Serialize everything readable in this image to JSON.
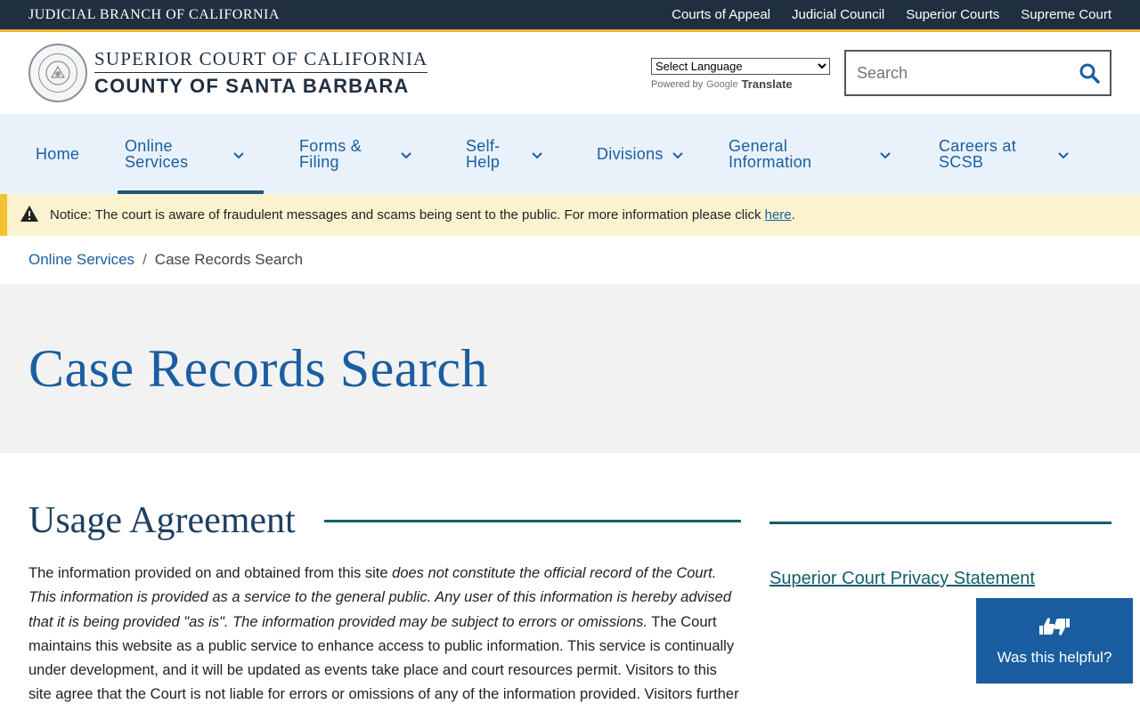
{
  "topbar": {
    "branch": "JUDICIAL BRANCH OF CALIFORNIA",
    "links": [
      "Courts of Appeal",
      "Judicial Council",
      "Superior Courts",
      "Supreme Court"
    ]
  },
  "header": {
    "title_line1": "SUPERIOR COURT OF CALIFORNIA",
    "title_line2": "COUNTY OF SANTA BARBARA",
    "language_select": "Select Language",
    "powered_by": "Powered by",
    "google": "Google",
    "translate": "Translate",
    "search_placeholder": "Search"
  },
  "nav": {
    "items": [
      {
        "label": "Home"
      },
      {
        "label": "Online Services"
      },
      {
        "label": "Forms & Filing"
      },
      {
        "label": "Self-Help"
      },
      {
        "label": "Divisions"
      },
      {
        "label": "General Information"
      },
      {
        "label": "Careers at SCSB"
      }
    ]
  },
  "notice": {
    "prefix": "Notice: The court is aware of fraudulent messages and scams being sent to the public. For more information please click ",
    "link": "here",
    "suffix": "."
  },
  "breadcrumb": {
    "parent": "Online Services",
    "separator": "/",
    "current": "Case Records Search"
  },
  "page": {
    "title": "Case Records Search",
    "section_title": "Usage Agreement",
    "p_start": "The information provided on and obtained from this site ",
    "p_italic": "does not constitute the official record of the Court. This information is provided as a service to the general public. Any user of this information is hereby advised that it is being provided \"as is\". The information provided may be subject to errors or omissions.",
    "p_end": " The Court maintains this website as a public service to enhance access to public information. This service is continually under development, and it will be updated as events take place and court resources permit. Visitors to this site agree that the Court is not liable for errors or omissions of any of the information provided. Visitors further consent"
  },
  "sidebar": {
    "privacy_link": "Superior Court Privacy Statement"
  },
  "feedback": {
    "label": "Was this helpful?"
  },
  "colors": {
    "topbar": "#1f2f40",
    "accent": "#f2b230",
    "link": "#1a5ea1",
    "teal": "#135e6b"
  }
}
